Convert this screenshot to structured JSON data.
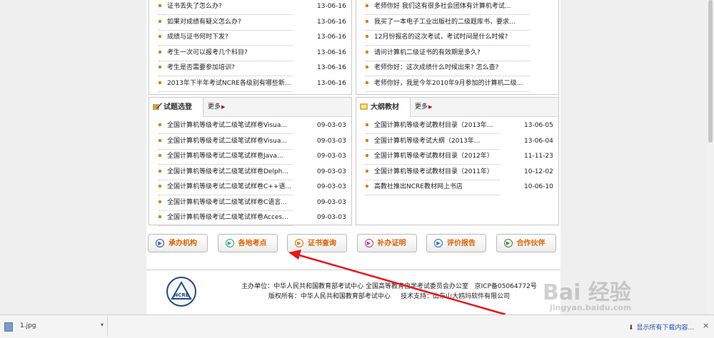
{
  "top_left_list": [
    {
      "title": "证书丢失了怎么办?",
      "date": "13-06-16"
    },
    {
      "title": "如果对成绩有疑义怎么办?",
      "date": "13-06-16"
    },
    {
      "title": "成绩与证书何时下发?",
      "date": "13-06-16"
    },
    {
      "title": "考生一次可以报考几个科目?",
      "date": "13-06-16"
    },
    {
      "title": "考生是否需要参加培训?",
      "date": "13-06-16"
    },
    {
      "title": "2013年下半年考试NCRE各级别有哪些新...",
      "date": "13-06-16"
    }
  ],
  "top_right_list": [
    {
      "title": "老师你好 我们这有很多社会团体有计算机考试..."
    },
    {
      "title": "我买了一本电子工业出版社的二级题库书，要求..."
    },
    {
      "title": "12月份报名的这次考试，考试时间是什么时候?"
    },
    {
      "title": "请问计算机二级证书的有效期是多久?"
    },
    {
      "title": "老师你好：这次成绩什么时候出来? 怎么查?"
    },
    {
      "title": "老师你好，我是今年2010年9月参加的计算机二级..."
    }
  ],
  "exam_panel": {
    "tab_label": "试题选登",
    "more_label": "更多",
    "items": [
      {
        "title": "全国计算机等级考试二级笔试样卷Visua...",
        "date": "09-03-03"
      },
      {
        "title": "全国计算机等级考试二级笔试样卷Visua...",
        "date": "09-03-03"
      },
      {
        "title": "全国计算机等级考试二级笔试样卷Java...",
        "date": "09-03-03"
      },
      {
        "title": "全国计算机等级考试二级笔试样卷Delph...",
        "date": "09-03-03"
      },
      {
        "title": "全国计算机等级考试二级笔试样卷C++语...",
        "date": "09-03-03"
      },
      {
        "title": "全国计算机等级考试二级笔试样卷C语言...",
        "date": "09-03-03"
      },
      {
        "title": "全国计算机等级考试二级笔试样卷Acces...",
        "date": "09-03-03"
      }
    ]
  },
  "syllabus_panel": {
    "tab_label": "大纲教材",
    "more_label": "更多",
    "items": [
      {
        "title": "全国计算机等级考试教材目录（2013年...",
        "date": "13-06-05"
      },
      {
        "title": "全国计算机等级考试大纲（2013年...",
        "date": "13-06-04"
      },
      {
        "title": "全国计算机等级考试教材目录（2012年）",
        "date": "11-11-23"
      },
      {
        "title": "全国计算机等级考试教材目录（2011年）",
        "date": "10-12-02"
      },
      {
        "title": "高教社推出NCRE教材网上书店",
        "date": "10-06-10"
      }
    ]
  },
  "quick_buttons": [
    {
      "label": "承办机构",
      "icon_color": "#2a5aa8"
    },
    {
      "label": "各地考点",
      "icon_color": "#2aa88a"
    },
    {
      "label": "证书查询",
      "icon_color": "#e07b00"
    },
    {
      "label": "补办证明",
      "icon_color": "#d0308a"
    },
    {
      "label": "评价报告",
      "icon_color": "#2a6ad0"
    },
    {
      "label": "合作伙伴",
      "icon_color": "#3a8a2a"
    }
  ],
  "footer": {
    "logo_text": "NCRE",
    "line1_org": "主办单位：中华人民共和国教育部考试中心 全国高等教育自学考试委员会办公室",
    "line1_icp": "京ICP备05064772号",
    "line2_copyright": "版权所有：中华人民共和国教育部考试中心",
    "line2_support": "技术支持：山东山大鸥玛软件有限公司"
  },
  "download_bar": {
    "file_name": "1.jpg",
    "show_all": "显示所有下载内容..."
  },
  "watermark": {
    "brand": "Bai 经验",
    "url": "jingyan.baidu.com"
  },
  "colors": {
    "accent_orange": "#e06000",
    "bullet": "#e07b00",
    "annotation_arrow": "#e8161b"
  }
}
